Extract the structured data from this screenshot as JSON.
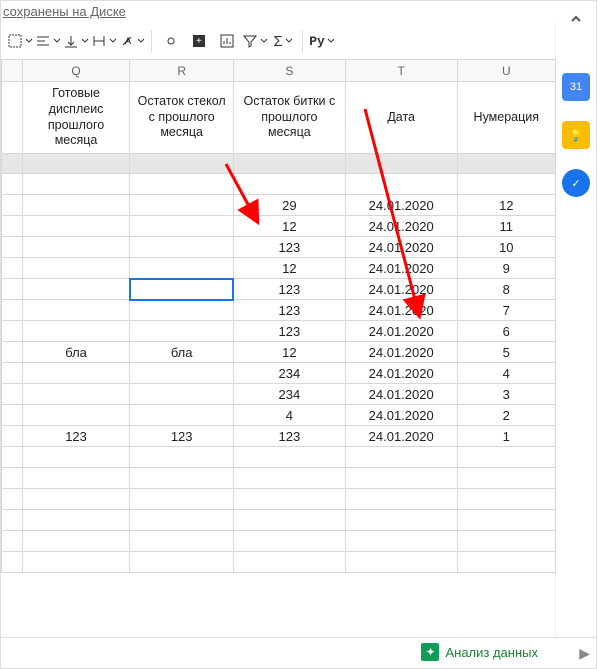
{
  "status": {
    "text": "сохранены на Диске"
  },
  "toolbar": {
    "collapse_aria": "Collapse toolbar",
    "functions_label": "Py"
  },
  "columns": [
    "Q",
    "R",
    "S",
    "T",
    "U"
  ],
  "headers": {
    "Q": "Готовые дисплеис прошлого месяца",
    "R": "Остаток стекол с прошлого месяца",
    "S": "Остаток битки с прошлого месяца",
    "T": "Дата",
    "U": "Нумерация"
  },
  "rows": [
    {
      "Q": "",
      "R": "",
      "S": "",
      "T": "",
      "U": ""
    },
    {
      "Q": "",
      "R": "",
      "S": "29",
      "T": "24.01.2020",
      "U": "12"
    },
    {
      "Q": "",
      "R": "",
      "S": "12",
      "T": "24.01.2020",
      "U": "11"
    },
    {
      "Q": "",
      "R": "",
      "S": "123",
      "T": "24.01.2020",
      "U": "10"
    },
    {
      "Q": "",
      "R": "",
      "S": "12",
      "T": "24.01.2020",
      "U": "9"
    },
    {
      "Q": "",
      "R": "",
      "S": "123",
      "T": "24.01.2020",
      "U": "8"
    },
    {
      "Q": "",
      "R": "",
      "S": "123",
      "T": "24.01.2020",
      "U": "7"
    },
    {
      "Q": "",
      "R": "",
      "S": "123",
      "T": "24.01.2020",
      "U": "6"
    },
    {
      "Q": "бла",
      "R": "бла",
      "S": "12",
      "T": "24.01.2020",
      "U": "5"
    },
    {
      "Q": "",
      "R": "",
      "S": "234",
      "T": "24.01.2020",
      "U": "4"
    },
    {
      "Q": "",
      "R": "",
      "S": "234",
      "T": "24.01.2020",
      "U": "3"
    },
    {
      "Q": "",
      "R": "",
      "S": "4",
      "T": "24.01.2020",
      "U": "2"
    },
    {
      "Q": "123",
      "R": "123",
      "S": "123",
      "T": "24.01.2020",
      "U": "1"
    }
  ],
  "blank_trailing_rows": 6,
  "selected": {
    "row_index": 5,
    "col": "R"
  },
  "explore": {
    "label": "Анализ данных"
  },
  "rail": {
    "calendar": "31",
    "keep": "●",
    "tasks": "✓"
  }
}
